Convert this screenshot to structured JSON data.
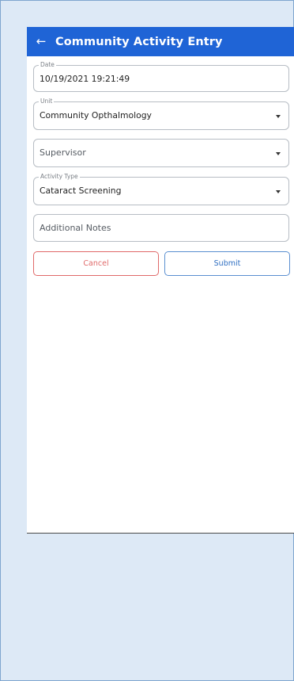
{
  "appbar": {
    "back_icon": "←",
    "title": "Community Activity Entry"
  },
  "form": {
    "date": {
      "label": "Date",
      "value": "10/19/2021 19:21:49"
    },
    "unit": {
      "label": "Unit",
      "value": "Community Opthalmology"
    },
    "supervisor": {
      "placeholder": "Supervisor"
    },
    "activity_type": {
      "label": "Activity Type",
      "value": "Cataract Screening"
    },
    "notes": {
      "placeholder": "Additional Notes"
    }
  },
  "actions": {
    "cancel_label": "Cancel",
    "submit_label": "Submit"
  },
  "colors": {
    "appbar": "#1f64d6",
    "cancel": "#e06a6a",
    "submit": "#2f6fc2",
    "frame": "#dde9f6"
  }
}
